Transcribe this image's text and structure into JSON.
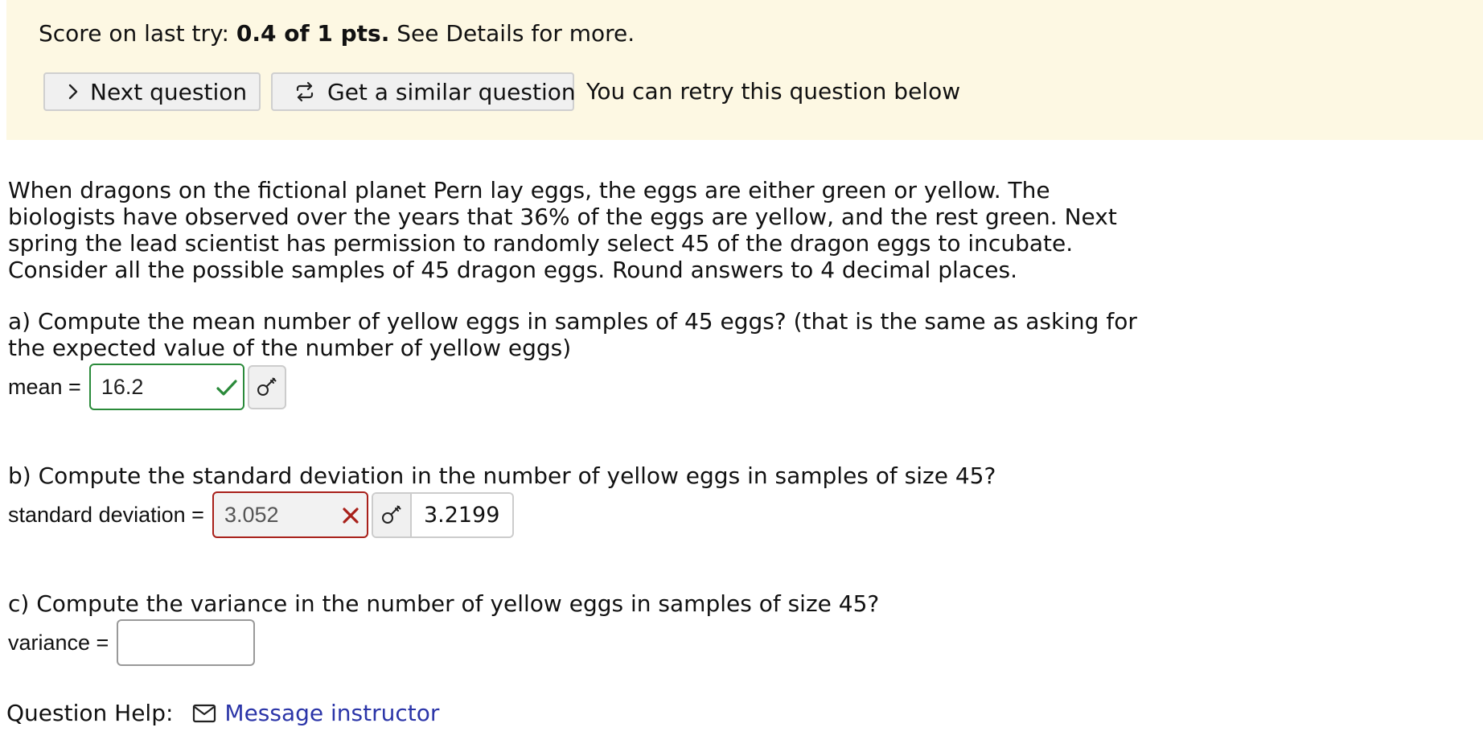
{
  "banner": {
    "score_prefix": "Score on last try: ",
    "score_value": "0.4 of 1 pts.",
    "score_suffix": " See Details for more.",
    "next_button_label": "Next question",
    "similar_button_label": "Get a similar question",
    "retry_note": "You can retry this question below",
    "colors": {
      "background": "#fdf8e3"
    }
  },
  "problem": {
    "text": "When dragons on the fictional planet Pern lay eggs, the eggs are either green or yellow. The biologists have observed over the years that 36% of the eggs are yellow, and the rest green. Next spring the lead scientist has permission to randomly select 45 of the dragon eggs to incubate. Consider all the possible samples of 45 dragon eggs. Round answers to 4 decimal places."
  },
  "parts": {
    "a": {
      "question": "a) Compute the mean number of yellow eggs in samples of 45 eggs? (that is the same as asking for the expected value of the number of yellow eggs)",
      "label": "mean =",
      "value": "16.2",
      "status": "correct",
      "status_icon": "checkmark-icon",
      "color": "#2a8a3a"
    },
    "b": {
      "question": "b) Compute the standard deviation in the number of yellow eggs in samples of size 45?",
      "label": "standard deviation =",
      "value": "3.052",
      "status": "incorrect",
      "status_icon": "x-mark-icon",
      "color": "#a8201a",
      "revealed_answer": "3.2199"
    },
    "c": {
      "question": "c) Compute the variance in the number of yellow eggs in samples of size 45?",
      "label": "variance =",
      "value": ""
    }
  },
  "help": {
    "label": "Question Help:",
    "link_label": "Message instructor",
    "link_color": "#2b35a8"
  }
}
